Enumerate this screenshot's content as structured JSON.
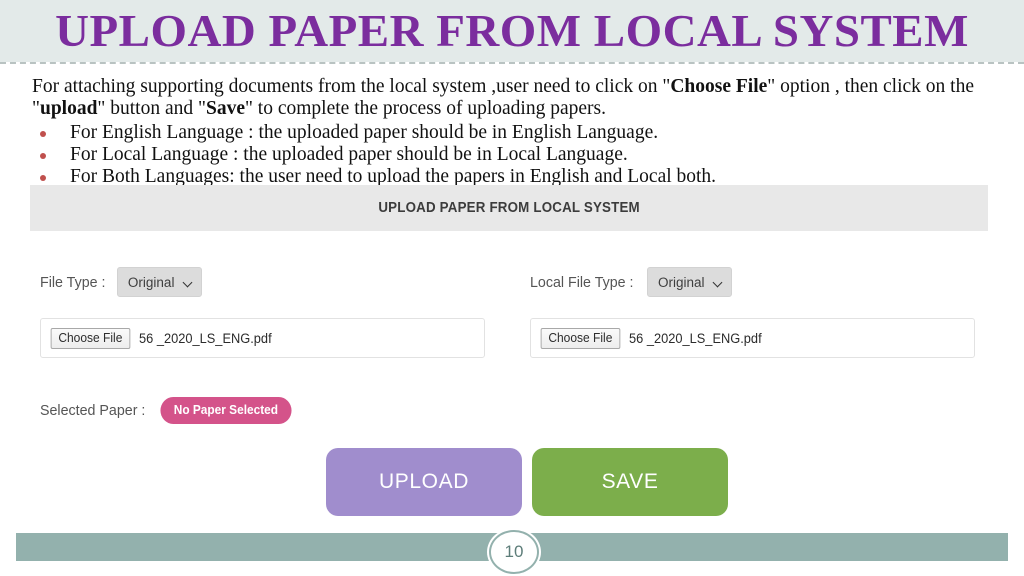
{
  "slide": {
    "title": "UPLOAD PAPER FROM LOCAL SYSTEM",
    "accent_purple": "#7b2d9e",
    "title_band_color": "#e3eae9"
  },
  "body": {
    "intro_part1": "For attaching supporting documents from the local system ,user need to click on \"",
    "intro_bold1": "Choose File",
    "intro_part2": "\" option , then click on the \"",
    "intro_bold2": "upload",
    "intro_part3": "\" button and \"",
    "intro_bold3": "Save",
    "intro_part4": "\" to complete the process of uploading papers.",
    "bullets": [
      "For English Language : the uploaded paper should be in English Language.",
      "For Local Language : the uploaded paper should be in Local Language.",
      "For Both Languages: the user need to upload the papers in English and Local both."
    ],
    "bullet_color": "#c0504d"
  },
  "form": {
    "header_title": "UPLOAD PAPER FROM LOCAL SYSTEM",
    "left": {
      "file_type_label": "File Type :",
      "file_type_value": "Original",
      "choose_file_label": "Choose File",
      "file_name": "56 _2020_LS_ENG.pdf"
    },
    "right": {
      "local_file_type_label": "Local File Type :",
      "local_file_type_value": "Original",
      "choose_file_label": "Choose File",
      "file_name": "56 _2020_LS_ENG.pdf"
    },
    "selected_paper_label": "Selected Paper :",
    "selected_paper_status": "No Paper Selected",
    "selected_paper_status_color": "#d4538a",
    "upload_button": "UPLOAD",
    "upload_button_color": "#a08dcd",
    "save_button": "SAVE",
    "save_button_color": "#7cae4b"
  },
  "footer": {
    "page_number": "10",
    "bar_color": "#93b1ad"
  }
}
